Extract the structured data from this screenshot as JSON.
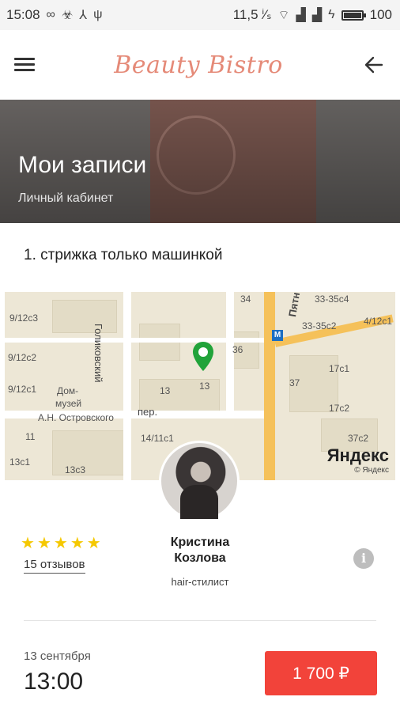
{
  "status_bar": {
    "time": "15:08",
    "left_icons": [
      "infinity-icon",
      "biohazard-icon",
      "network-icon",
      "usb-icon"
    ],
    "data_speed": "11,5 ⁱ⁄ₛ",
    "battery_level": "100"
  },
  "app_bar": {
    "brand": "Beauty Bistro",
    "menu_icon": "hamburger-menu-icon",
    "back_icon": "arrow-back-icon"
  },
  "header": {
    "title": "Мои записи",
    "subtitle": "Личный кабинет"
  },
  "booking": {
    "service": "1. стрижка только машинкой",
    "map": {
      "labels": [
        "34",
        "33-35с4",
        "9/12с3",
        "33-35с2",
        "4/12с1",
        "Голиковский",
        "36",
        "9/12с2",
        "Дом-",
        "музей",
        "А.Н. Островского",
        "17с1",
        "37",
        "9/12с1",
        "13",
        "13",
        "пер.",
        "17с2",
        "11",
        "14/11с1",
        "37с2",
        "13с1",
        "13с3"
      ],
      "street_main": "Пятн",
      "provider": "Яндекс",
      "copyright": "© Яндекс"
    },
    "master": {
      "name": "Кристина Козлова",
      "role": "hair-стилист",
      "rating": 5,
      "reviews": "15 отзывов"
    },
    "date": "13 сентября",
    "time": "13:00",
    "price": "1 700 ₽",
    "colors": {
      "price_button": "#f2433a",
      "stars": "#f5c800",
      "brand": "#e58a78"
    }
  }
}
